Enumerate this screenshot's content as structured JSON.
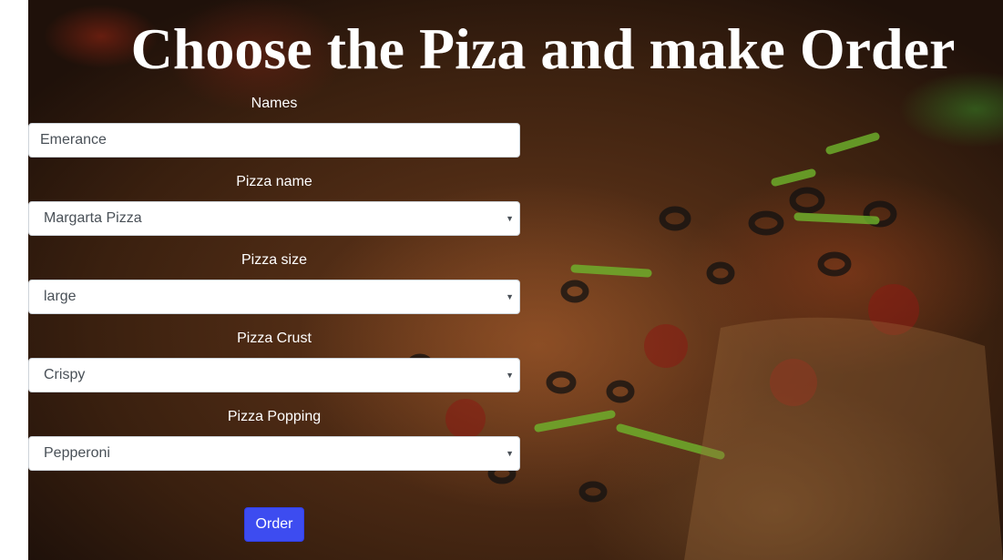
{
  "page": {
    "title": "Choose the Piza and make Order"
  },
  "form": {
    "names": {
      "label": "Names",
      "value": "Emerance"
    },
    "pizza_name": {
      "label": "Pizza name",
      "value": "Margarta Pizza"
    },
    "pizza_size": {
      "label": "Pizza size",
      "value": "large"
    },
    "pizza_crust": {
      "label": "Pizza Crust",
      "value": "Crispy"
    },
    "pizza_topping": {
      "label": "Pizza Popping",
      "value": "Pepperoni"
    },
    "order_label": "Order"
  },
  "colors": {
    "button": "#3d4cf0",
    "title_text": "#ffffff",
    "label_text": "#ffffff"
  },
  "icons": {
    "select_caret": "chevron-down-icon"
  }
}
